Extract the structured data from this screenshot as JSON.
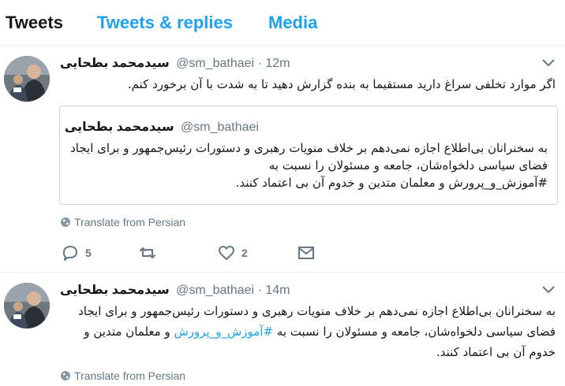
{
  "tabs": [
    {
      "label": "Tweets",
      "active": true
    },
    {
      "label": "Tweets & replies",
      "active": false
    },
    {
      "label": "Media",
      "active": false
    }
  ],
  "colors": {
    "accent": "#1da1f2",
    "text": "#14171a",
    "muted": "#657786",
    "border": "#e6ecf0"
  },
  "tweets": [
    {
      "author_name": "سیدمحمد بطحایی",
      "handle": "@sm_bathaei",
      "separator": "·",
      "time": "12m",
      "text": "اگر موارد تخلفی سراغ دارید مستقیما به بنده گزارش دهید تا به شدت با آن برخورد کنم.",
      "quote": {
        "author_name": "سیدمحمد بطحایی",
        "handle": "@sm_bathaei",
        "text": "به سخنرانان بی‌اطلاع اجازه نمی‌دهم بر خلاف منویات رهبری و دستورات رئیس‌جمهور و برای ایجاد فضای سیاسی دلخواه‌شان، جامعه و مسئولان را نسبت به",
        "text_hashtag": "#آموزش_و_پرورش",
        "text_end": " و معلمان متدین و خدوم آن بی اعتماد کنند."
      },
      "translate_label": "Translate from Persian",
      "reply_count": "5",
      "retweet_count": "",
      "like_count": "2"
    },
    {
      "author_name": "سیدمحمد بطحایی",
      "handle": "@sm_bathaei",
      "separator": "·",
      "time": "14m",
      "text_start": "به سخنرانان بی‌اطلاع اجازه نمی‌دهم بر خلاف منویات رهبری و دستورات رئیس‌جمهور و برای ایجاد فضای سیاسی دلخواه‌شان، جامعه و مسئولان را نسبت به ",
      "text_hashtag": "#آموزش_و_پرورش",
      "text_end": " و معلمان متدین و خدوم آن بی اعتماد کنند.",
      "translate_label": "Translate from Persian"
    }
  ],
  "icons": {
    "caret": "chevron-down-icon",
    "globe": "globe-icon",
    "reply": "reply-icon",
    "retweet": "retweet-icon",
    "like": "heart-icon",
    "dm": "envelope-icon"
  }
}
